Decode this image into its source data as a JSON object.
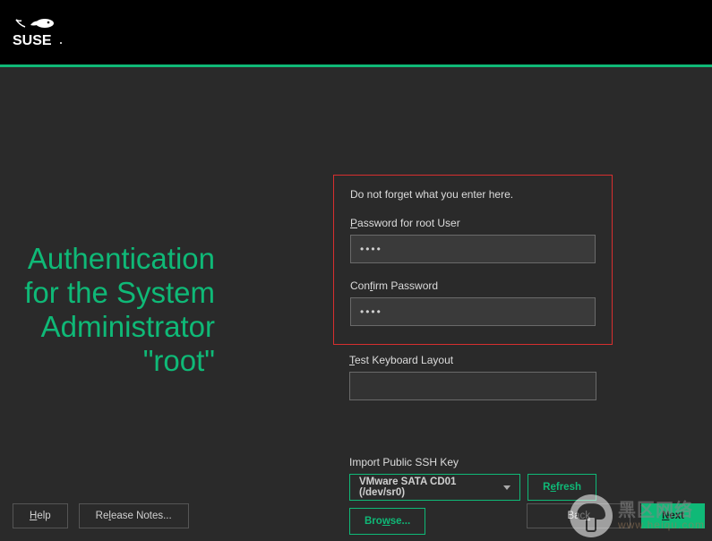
{
  "brand": "SUSE",
  "title": "Authentication for the System Administrator \"root\"",
  "hint": "Do not forget what you enter here.",
  "labels": {
    "password_pre": "P",
    "password_rest": "assword for root User",
    "confirm_pre": "Con",
    "confirm_u": "f",
    "confirm_rest": "irm Password",
    "test_pre": "T",
    "test_rest": "est Keyboard Layout",
    "ssh": "Import Public SSH Key"
  },
  "fields": {
    "password_value": "••••",
    "confirm_value": "••••",
    "test_value": ""
  },
  "ssh": {
    "selected": "VMware SATA CD01 (/dev/sr0)",
    "refresh_pre": "R",
    "refresh_u": "e",
    "refresh_rest": "fresh",
    "browse_pre": "Bro",
    "browse_u": "w",
    "browse_rest": "se..."
  },
  "footer": {
    "help_pre": "H",
    "help_rest": "elp",
    "release_pre": "Re",
    "release_u": "l",
    "release_rest": "ease Notes...",
    "back_pre": "Bac",
    "back_u": "k",
    "next_pre": "N",
    "next_rest": "ext"
  },
  "watermark": {
    "big": "黑区网络",
    "small": "www.heiqu.com"
  }
}
